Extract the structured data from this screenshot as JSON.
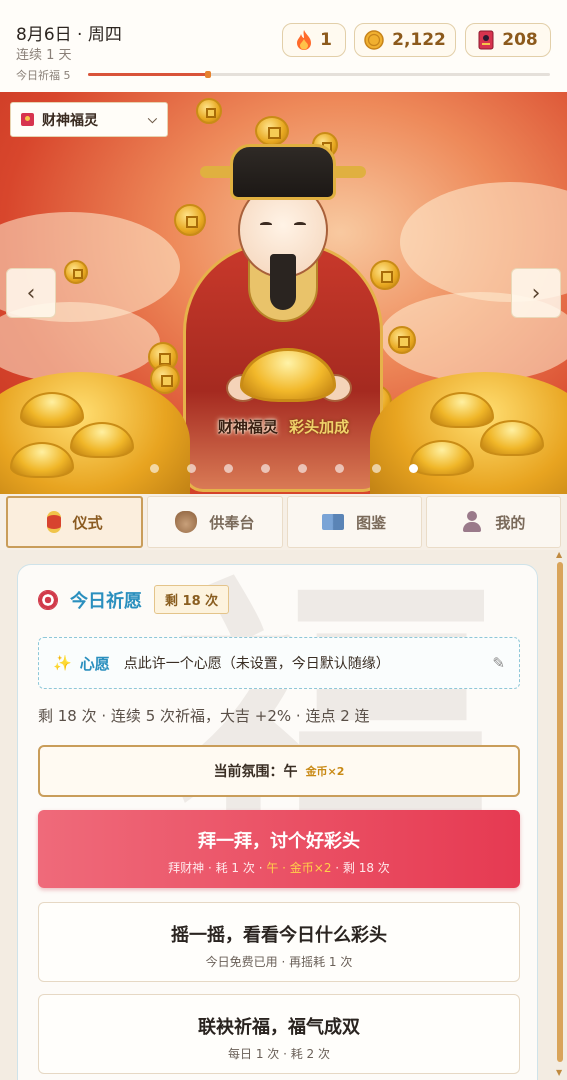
{
  "header": {
    "date": "8月6日 · 周四",
    "streak": "连续 1 天",
    "bless_label": "今日祈福 5",
    "bless_progress": 0.26,
    "counters": {
      "fire": "1",
      "coins": "2,122",
      "cards": "208"
    }
  },
  "banner": {
    "realm_select": "财神福灵",
    "caption_name": "财神福灵",
    "caption_bonus": "彩头加成",
    "prev_label": "‹",
    "next_label": "›",
    "dots_total": 8,
    "dots_active": 8
  },
  "tabs": [
    {
      "label": "仪式",
      "icon": "lantern-icon",
      "active": true
    },
    {
      "label": "供奉台",
      "icon": "offering-bowl-icon",
      "active": false
    },
    {
      "label": "图鉴",
      "icon": "book-icon",
      "active": false
    },
    {
      "label": "我的",
      "icon": "user-icon",
      "active": false
    }
  ],
  "card": {
    "title": "今日祈愿",
    "remaining_badge": "剩 18 次",
    "watermark": "福",
    "wish_label": "心愿",
    "wish_text": "点此许一个心愿（未设置，今日默认随缘）",
    "status_line": "剩 18 次 · 连续 5 次祈福，大吉 +2% · 连点 2 连",
    "atmosphere_label": "当前氛围：午",
    "atmosphere_tag": "金币×2",
    "pray_button": {
      "title": "拜一拜，讨个好彩头",
      "sub_prefix": "拜财神 · 耗 1 次 · ",
      "sub_highlight": "午 · 金币×2",
      "sub_suffix": " · 剩 18 次"
    },
    "shake_button": {
      "title": "摇一摇，看看今日什么彩头",
      "sub": "今日免费已用 · 再摇耗 1 次"
    },
    "combo_button": {
      "title": "联袂祈福，福气成双",
      "sub": "每日 1 次 · 耗 2 次"
    }
  },
  "colors": {
    "accent_blue": "#2a8fbe",
    "primary_red": "#e63a52",
    "gold": "#c99d5a"
  }
}
